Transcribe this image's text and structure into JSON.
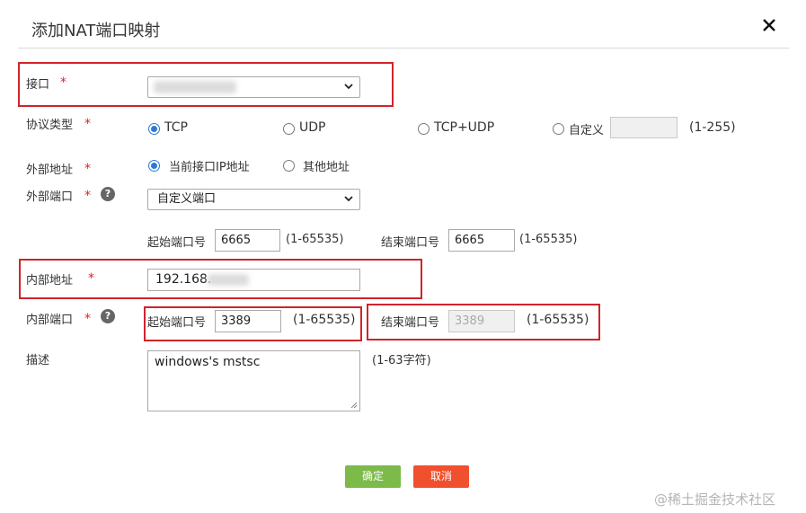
{
  "dialog": {
    "title": "添加NAT端口映射"
  },
  "form": {
    "interface": {
      "label": "接口",
      "required": "*"
    },
    "protocol": {
      "label": "协议类型",
      "required": "*",
      "options": [
        "TCP",
        "UDP",
        "TCP+UDP",
        "自定义"
      ],
      "selected": "TCP",
      "custom_value": "",
      "custom_hint": "(1-255)"
    },
    "external_address": {
      "label": "外部地址",
      "required": "*",
      "options": [
        "当前接口IP地址",
        "其他地址"
      ],
      "selected": "当前接口IP地址"
    },
    "external_port": {
      "label": "外部端口",
      "required": "*",
      "help": "?",
      "mode": "自定义端口",
      "start_label": "起始端口号",
      "start_value": "6665",
      "start_hint": "(1-65535)",
      "end_label": "结束端口号",
      "end_value": "6665",
      "end_hint": "(1-65535)"
    },
    "internal_address": {
      "label": "内部地址",
      "required": "*",
      "value": "192.168."
    },
    "internal_port": {
      "label": "内部端口",
      "required": "*",
      "help": "?",
      "start_label": "起始端口号",
      "start_value": "3389",
      "start_hint": "(1-65535)",
      "end_label": "结束端口号",
      "end_value": "3389",
      "end_hint": "(1-65535)"
    },
    "description": {
      "label": "描述",
      "value": "windows's mstsc",
      "hint": "(1-63字符)"
    }
  },
  "buttons": {
    "ok": "确定",
    "cancel": "取消"
  },
  "watermark": "@稀土掘金技术社区",
  "colors": {
    "highlight": "#d0242b",
    "ok": "#7cba4a",
    "cancel": "#f1502e",
    "radio_checked": "#2b7bd6",
    "required": "#e02020"
  }
}
